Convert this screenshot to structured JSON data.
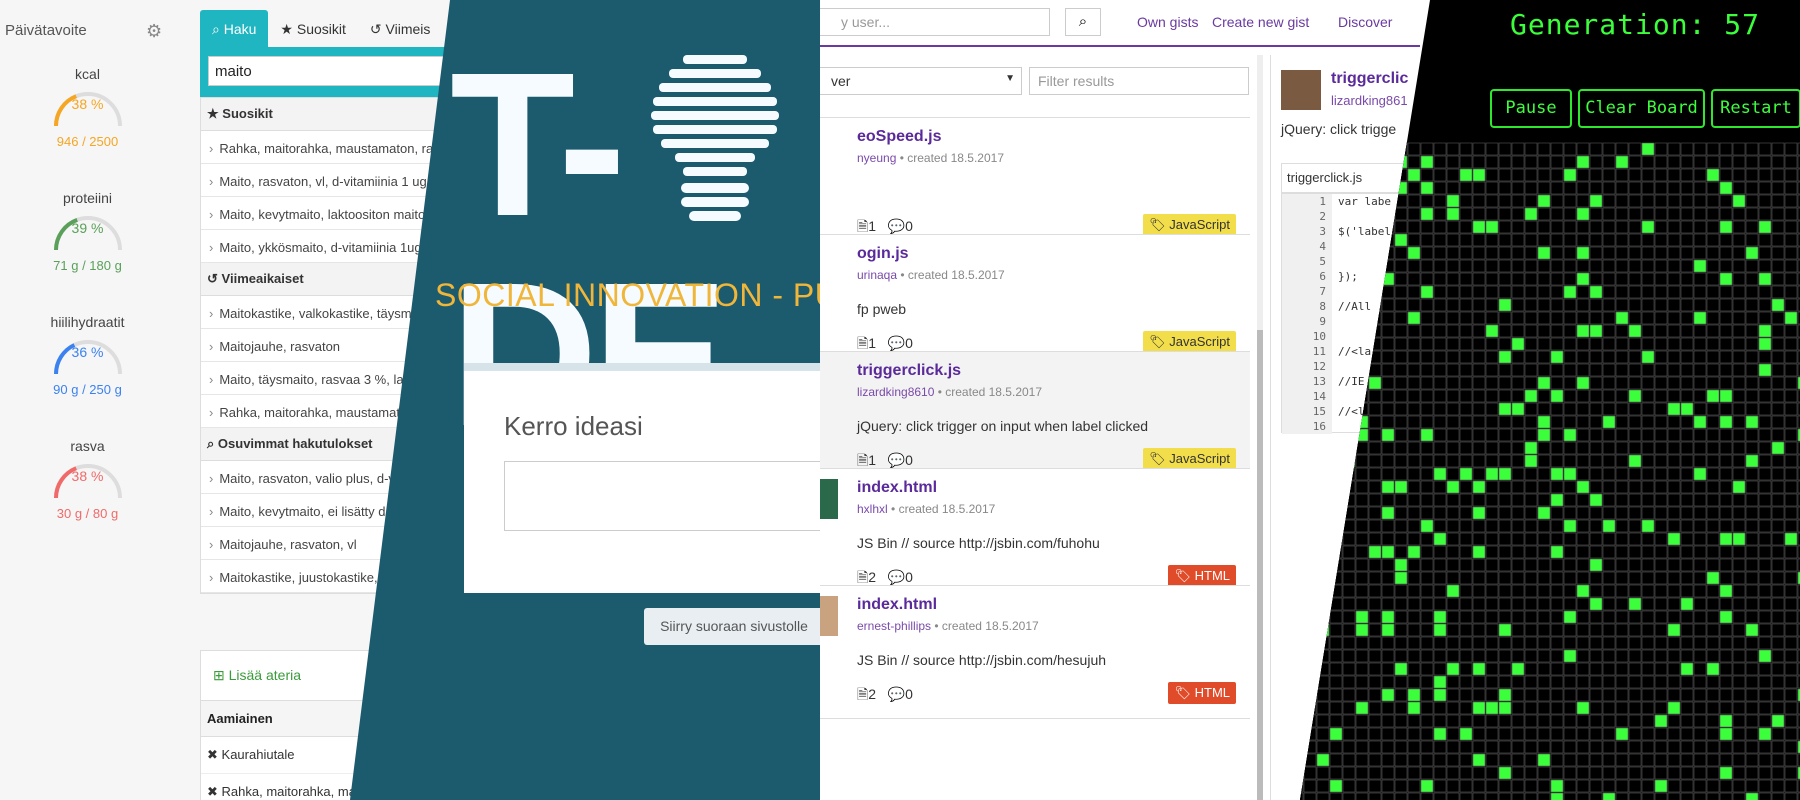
{
  "nutrition": {
    "sidebar_title": "Päivätavoite",
    "settings_icon": "gear-icon",
    "gauges": [
      {
        "label": "kcal",
        "percent_text": "38 %",
        "amount": "946 / 2500",
        "fraction": 0.38,
        "color": "#f5a623"
      },
      {
        "label": "proteiini",
        "percent_text": "39 %",
        "amount": "71 g / 180 g",
        "fraction": 0.39,
        "color": "#5aa05a"
      },
      {
        "label": "hiilihydraatit",
        "percent_text": "36 %",
        "amount": "90 g / 250 g",
        "fraction": 0.36,
        "color": "#3b82f0"
      },
      {
        "label": "rasva",
        "percent_text": "38 %",
        "amount": "30 g / 80 g",
        "fraction": 0.38,
        "color": "#f06a6a"
      }
    ],
    "tabs": [
      {
        "label": "Haku",
        "icon": "search-icon",
        "active": true
      },
      {
        "label": "Suosikit",
        "icon": "star-icon",
        "active": false
      },
      {
        "label": "Viimeis",
        "icon": "history-icon",
        "active": false
      }
    ],
    "search_value": "maito",
    "groups": [
      {
        "title": "Suosikit",
        "icon": "star-icon",
        "items": [
          "Rahka, maitorahka, maustamaton, ra",
          "Maito, rasvaton, vl, d-vitamiinia 1 ug",
          "Maito, kevytmaito, laktoositon maito",
          "Maito, ykkösmaito, d-vitamiinia 1ug"
        ]
      },
      {
        "title": "Viimeaikaiset",
        "icon": "history-icon",
        "items": [
          "Maitokastike, valkokastike, täysm",
          "Maitojauhe, rasvaton",
          "Maito, täysmaito, rasvaa 3 %, lak",
          "Rahka, maitorahka, maustamat"
        ]
      },
      {
        "title": "Osuvimmat hakutulokset",
        "icon": "search-icon",
        "items": [
          "Maito, rasvaton, valio plus, d-v",
          "Maito, kevytmaito, ei lisätty d",
          "Maitojauhe, rasvaton, vl",
          "Maitokastike, juustokastike,"
        ]
      }
    ],
    "add_meal": "Lisää ateria",
    "meal_header": "Aamiainen",
    "meal_items": [
      "Kaurahiutale",
      "Rahka, maitorahka, ma"
    ]
  },
  "tide": {
    "logo_left": "T-",
    "logo_right": "DE",
    "tagline": "SOCIAL INNOVATION - PUT INT",
    "card_title": "Kerro ideasi",
    "button": "Siirry suoraan sivustolle"
  },
  "gists": {
    "search_placeholder": "y user...",
    "nav": [
      "Own gists",
      "Create new gist",
      "Discover"
    ],
    "filter_select": "ver",
    "filter_placeholder": "Filter results",
    "items": [
      {
        "name": "eoSpeed.js",
        "user": "nyeung",
        "created": "created 18.5.2017",
        "desc": "",
        "files": "1",
        "comments": "0",
        "tag": "JavaScript",
        "tag_type": "js",
        "selected": false
      },
      {
        "name": "ogin.js",
        "user": "urinaqa",
        "created": "created 18.5.2017",
        "desc": "fp pweb",
        "files": "1",
        "comments": "0",
        "tag": "JavaScript",
        "tag_type": "js",
        "selected": false
      },
      {
        "name": "triggerclick.js",
        "user": "lizardking8610",
        "created": "created 18.5.2017",
        "desc": "jQuery: click trigger on input when label clicked",
        "files": "1",
        "comments": "0",
        "tag": "JavaScript",
        "tag_type": "js",
        "selected": true
      },
      {
        "name": "index.html",
        "user": "hxlhxl",
        "created": "created 18.5.2017",
        "desc": "JS Bin // source http://jsbin.com/fuhohu",
        "files": "2",
        "comments": "0",
        "tag": "HTML",
        "tag_type": "html",
        "selected": false
      },
      {
        "name": "index.html",
        "user": "ernest-phillips",
        "created": "created 18.5.2017",
        "desc": "JS Bin // source http://jsbin.com/hesujuh",
        "files": "2",
        "comments": "0",
        "tag": "HTML",
        "tag_type": "html",
        "selected": false
      }
    ],
    "detail": {
      "name": "triggerclic",
      "user": "lizardking861",
      "desc": "jQuery: click trigge",
      "file": "triggerclick.js",
      "line_numbers": [
        "1",
        "2",
        "3",
        "4",
        "5",
        "6",
        "7",
        "8",
        "9",
        "10",
        "11",
        "12",
        "13",
        "14",
        "15",
        "16"
      ],
      "code_lines": [
        "var labe",
        "",
        "$('label",
        "",
        "",
        "});",
        "",
        "//All",
        "",
        "",
        "//<la",
        "",
        "//IE",
        "",
        "//<l",
        ""
      ]
    }
  },
  "life": {
    "generation": "Generation: 57",
    "buttons": [
      "Pause",
      "Clear Board",
      "Restart"
    ],
    "accent": "#3cff3c"
  }
}
